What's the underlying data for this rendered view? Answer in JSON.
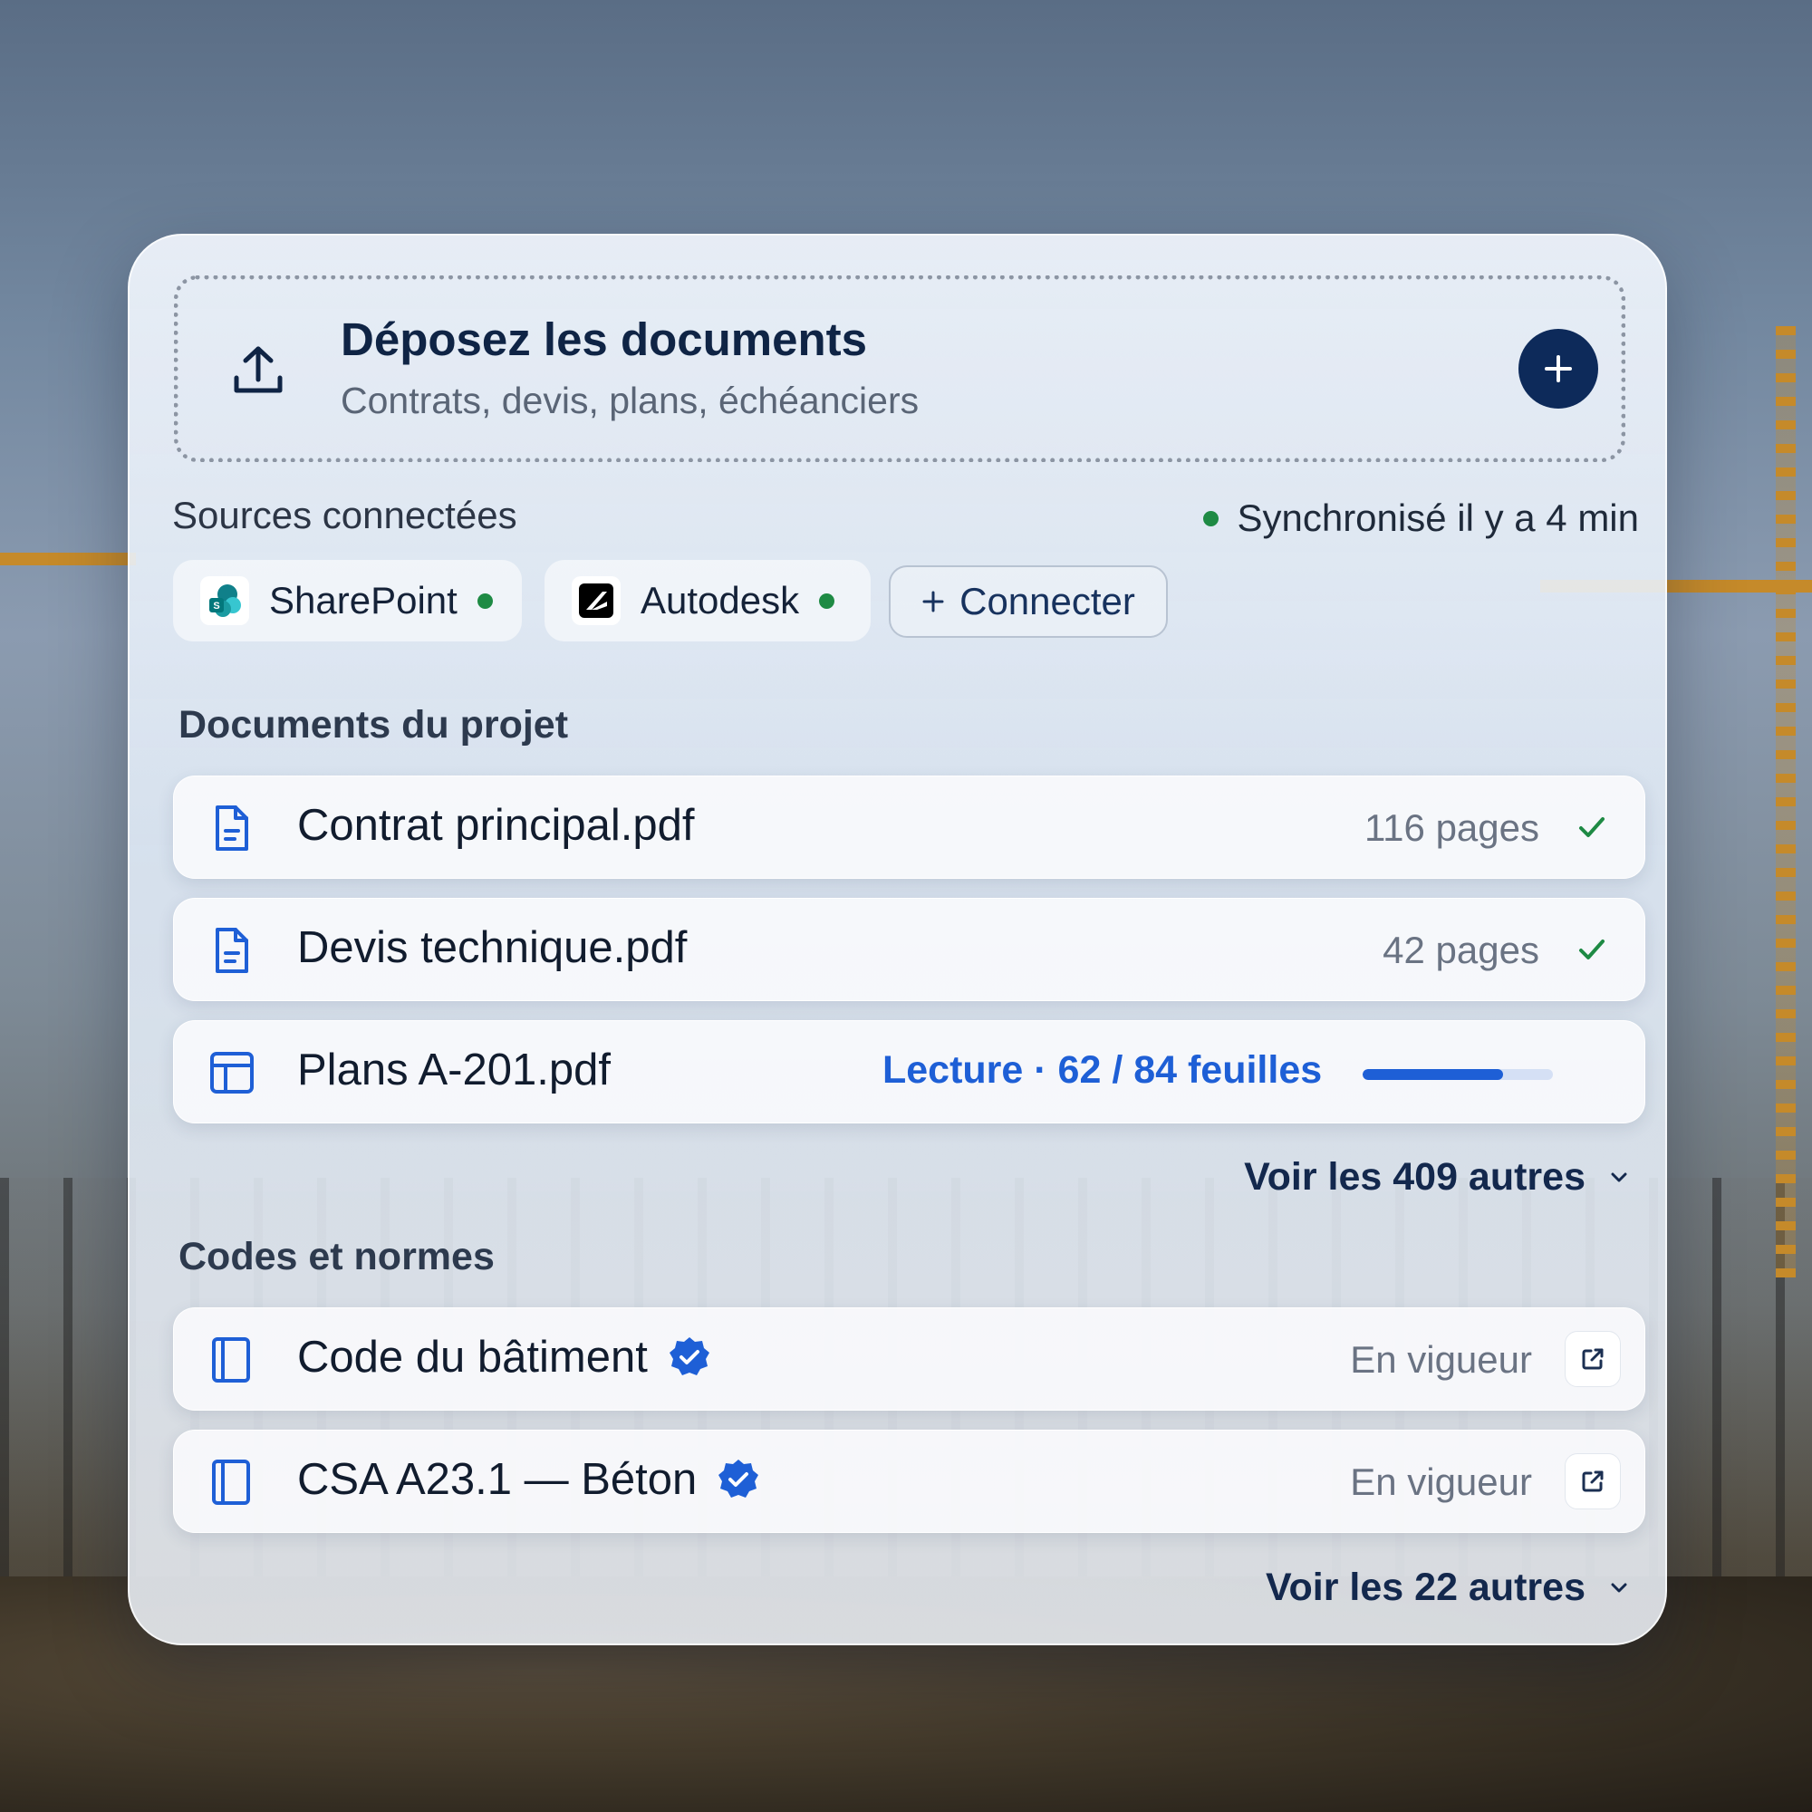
{
  "upload": {
    "title": "Déposez les documents",
    "subtitle": "Contrats, devis, plans, échéanciers"
  },
  "sources": {
    "label": "Sources connectées",
    "sync_status": "Synchronisé il y a 4 min",
    "items": [
      {
        "name": "SharePoint",
        "status_color": "#1e8a44"
      },
      {
        "name": "Autodesk",
        "status_color": "#1e8a44"
      }
    ],
    "connect_label": "Connecter"
  },
  "project_docs": {
    "heading": "Documents du projet",
    "items": [
      {
        "name": "Contrat principal.pdf",
        "meta": "116 pages",
        "icon": "file-text-icon",
        "done": true
      },
      {
        "name": "Devis technique.pdf",
        "meta": "42 pages",
        "icon": "file-text-icon",
        "done": true
      },
      {
        "name": "Plans A-201.pdf",
        "progress_label": "Lecture · 62 / 84 feuilles",
        "progress": 0.738,
        "icon": "layout-icon"
      }
    ],
    "more": "Voir les 409 autres"
  },
  "codes": {
    "heading": "Codes et normes",
    "items": [
      {
        "name": "Code du bâtiment",
        "status": "En vigueur",
        "icon": "book-icon",
        "verified": true
      },
      {
        "name": "CSA A23.1 — Béton",
        "status": "En vigueur",
        "icon": "book-icon",
        "verified": true
      }
    ],
    "more": "Voir les 22 autres"
  },
  "colors": {
    "accent": "#1e5fd6",
    "primary": "#0d2a5a",
    "success": "#1e8a44"
  }
}
